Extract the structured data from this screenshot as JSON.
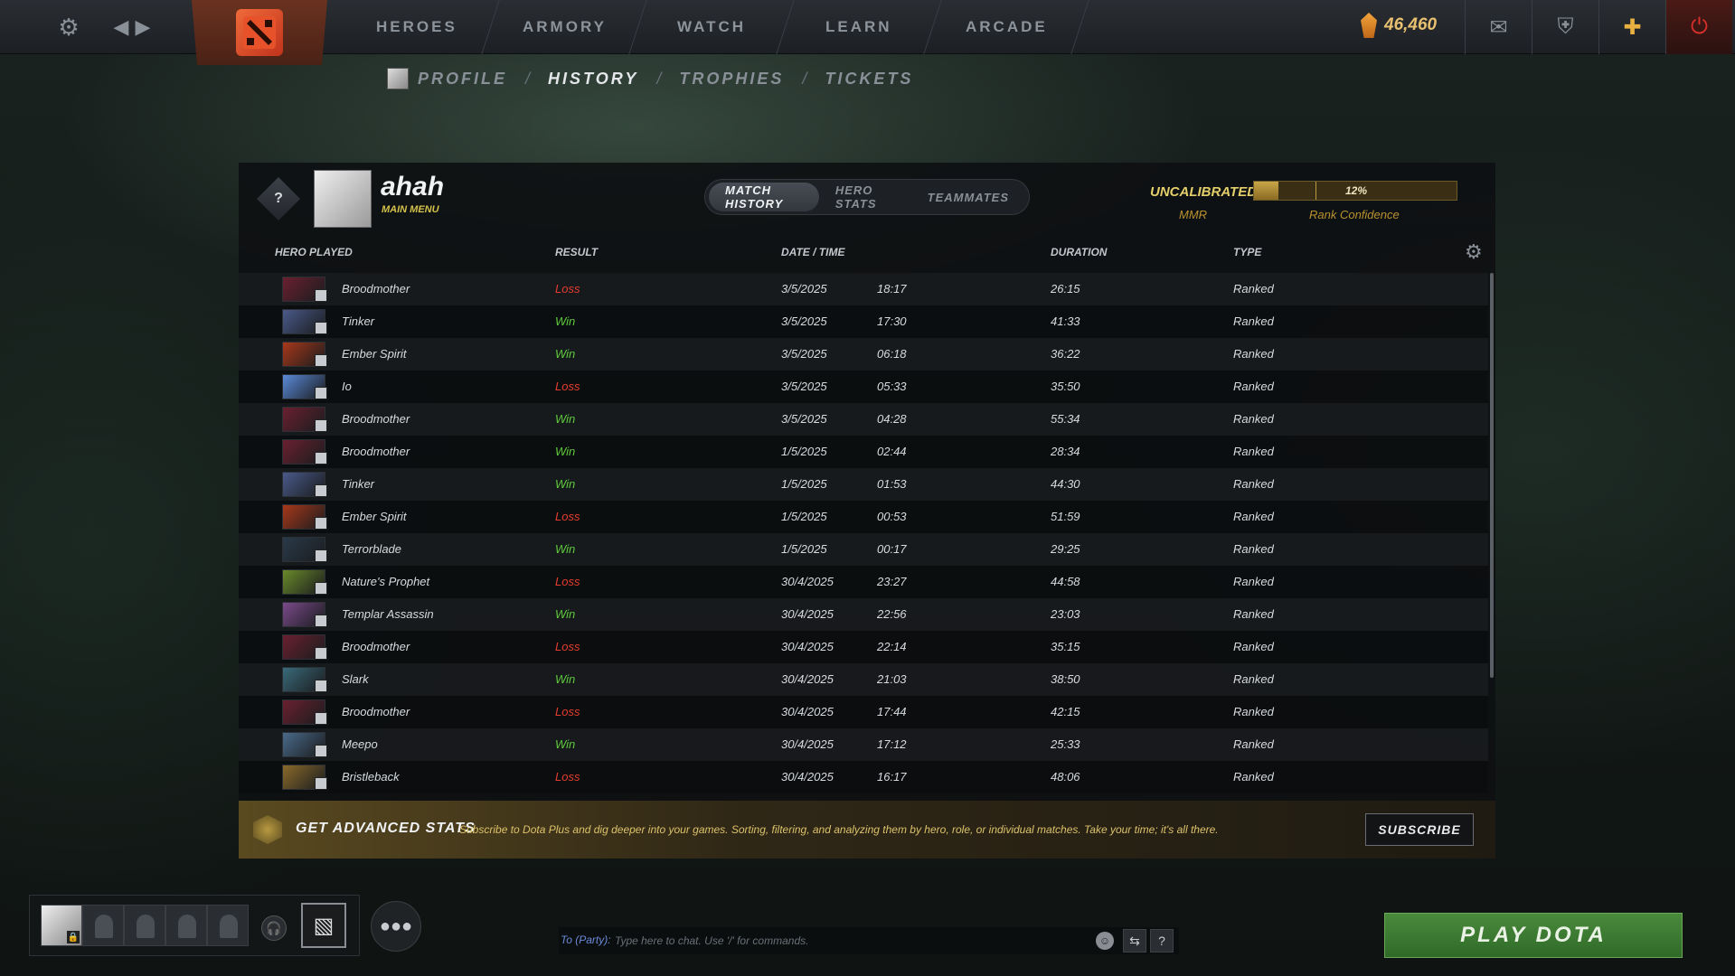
{
  "topbar": {
    "menu": [
      "HEROES",
      "ARMORY",
      "WATCH",
      "LEARN",
      "ARCADE"
    ],
    "currency": "46,460",
    "colors": {
      "accent": "#e8c070",
      "power": "#d8302a"
    }
  },
  "subnav": {
    "items": [
      "PROFILE",
      "HISTORY",
      "TROPHIES",
      "TICKETS"
    ],
    "active": "HISTORY",
    "slash": "/"
  },
  "profile": {
    "name": "ahah",
    "status": "MAIN MENU",
    "rank_symbol": "?"
  },
  "tabs": [
    "MATCH HISTORY",
    "HERO STATS",
    "TEAMMATES"
  ],
  "rank": {
    "uncalibrated": "UNCALIBRATED",
    "mmr_label": "MMR",
    "confidence_text": "12%",
    "confidence_fraction": 0.12,
    "confidence_label": "Rank Confidence"
  },
  "table": {
    "headers": [
      "HERO PLAYED",
      "RESULT",
      "DATE / TIME",
      "DURATION",
      "TYPE"
    ],
    "rows": [
      {
        "hero": "Broodmother",
        "result": "Loss",
        "date": "3/5/2025",
        "time": "18:17",
        "duration": "26:15",
        "type": "Ranked",
        "color": "#6a2030"
      },
      {
        "hero": "Tinker",
        "result": "Win",
        "date": "3/5/2025",
        "time": "17:30",
        "duration": "41:33",
        "type": "Ranked",
        "color": "#4a5a8a"
      },
      {
        "hero": "Ember Spirit",
        "result": "Win",
        "date": "3/5/2025",
        "time": "06:18",
        "duration": "36:22",
        "type": "Ranked",
        "color": "#a8381a"
      },
      {
        "hero": "Io",
        "result": "Loss",
        "date": "3/5/2025",
        "time": "05:33",
        "duration": "35:50",
        "type": "Ranked",
        "color": "#5a8ad8"
      },
      {
        "hero": "Broodmother",
        "result": "Win",
        "date": "3/5/2025",
        "time": "04:28",
        "duration": "55:34",
        "type": "Ranked",
        "color": "#6a2030"
      },
      {
        "hero": "Broodmother",
        "result": "Win",
        "date": "1/5/2025",
        "time": "02:44",
        "duration": "28:34",
        "type": "Ranked",
        "color": "#6a2030"
      },
      {
        "hero": "Tinker",
        "result": "Win",
        "date": "1/5/2025",
        "time": "01:53",
        "duration": "44:30",
        "type": "Ranked",
        "color": "#4a5a8a"
      },
      {
        "hero": "Ember Spirit",
        "result": "Loss",
        "date": "1/5/2025",
        "time": "00:53",
        "duration": "51:59",
        "type": "Ranked",
        "color": "#a8381a"
      },
      {
        "hero": "Terrorblade",
        "result": "Win",
        "date": "1/5/2025",
        "time": "00:17",
        "duration": "29:25",
        "type": "Ranked",
        "color": "#2a3a4a"
      },
      {
        "hero": "Nature's Prophet",
        "result": "Loss",
        "date": "30/4/2025",
        "time": "23:27",
        "duration": "44:58",
        "type": "Ranked",
        "color": "#6a8a2a"
      },
      {
        "hero": "Templar Assassin",
        "result": "Win",
        "date": "30/4/2025",
        "time": "22:56",
        "duration": "23:03",
        "type": "Ranked",
        "color": "#7a4a8a"
      },
      {
        "hero": "Broodmother",
        "result": "Loss",
        "date": "30/4/2025",
        "time": "22:14",
        "duration": "35:15",
        "type": "Ranked",
        "color": "#6a2030"
      },
      {
        "hero": "Slark",
        "result": "Win",
        "date": "30/4/2025",
        "time": "21:03",
        "duration": "38:50",
        "type": "Ranked",
        "color": "#3a6a7a"
      },
      {
        "hero": "Broodmother",
        "result": "Loss",
        "date": "30/4/2025",
        "time": "17:44",
        "duration": "42:15",
        "type": "Ranked",
        "color": "#6a2030"
      },
      {
        "hero": "Meepo",
        "result": "Win",
        "date": "30/4/2025",
        "time": "17:12",
        "duration": "25:33",
        "type": "Ranked",
        "color": "#4a6a8a"
      },
      {
        "hero": "Bristleback",
        "result": "Loss",
        "date": "30/4/2025",
        "time": "16:17",
        "duration": "48:06",
        "type": "Ranked",
        "color": "#8a6a2a"
      }
    ]
  },
  "promo": {
    "title": "GET ADVANCED STATS",
    "text": "Subscribe to Dota Plus and dig deeper into your games. Sorting, filtering, and analyzing them by hero, role, or individual matches. Take your time; it's all there.",
    "button": "SUBSCRIBE"
  },
  "chat": {
    "prefix": "To (Party):",
    "placeholder": "Type here to chat. Use '/' for commands.",
    "help": "?"
  },
  "play_button": "PLAY DOTA",
  "icons": {
    "settings": "gear-icon",
    "back": "chevron-left-icon",
    "forward": "chevron-right-icon",
    "mail": "mail-icon",
    "armory": "armory-icon",
    "dota_plus": "plus-icon",
    "power": "power-icon"
  }
}
